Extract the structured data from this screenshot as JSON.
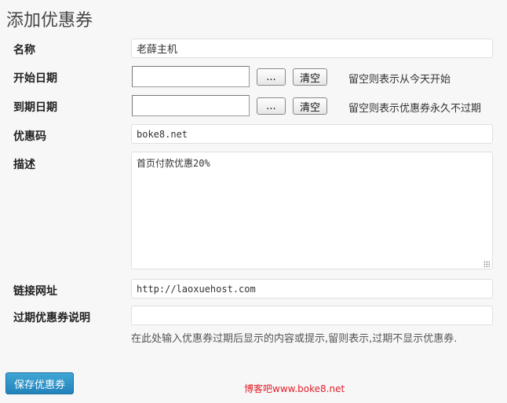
{
  "page": {
    "title": "添加优惠券"
  },
  "form": {
    "name": {
      "label": "名称",
      "value": "老薛主机"
    },
    "start_date": {
      "label": "开始日期",
      "value": "",
      "pick_label": "...",
      "clear_label": "清空",
      "hint": "留空则表示从今天开始"
    },
    "end_date": {
      "label": "到期日期",
      "value": "",
      "pick_label": "...",
      "clear_label": "清空",
      "hint": "留空则表示优惠券永久不过期"
    },
    "code": {
      "label": "优惠码",
      "value": "boke8.net"
    },
    "description": {
      "label": "描述",
      "value": "首页付款优惠20%"
    },
    "link": {
      "label": "链接网址",
      "value": "http://laoxuehost.com"
    },
    "expired_note": {
      "label": "过期优惠券说明",
      "value": "",
      "help": "在此处输入优惠券过期后显示的内容或提示,留则表示,过期不显示优惠券."
    },
    "save_label": "保存优惠券"
  },
  "watermark": "博客吧www.boke8.net"
}
